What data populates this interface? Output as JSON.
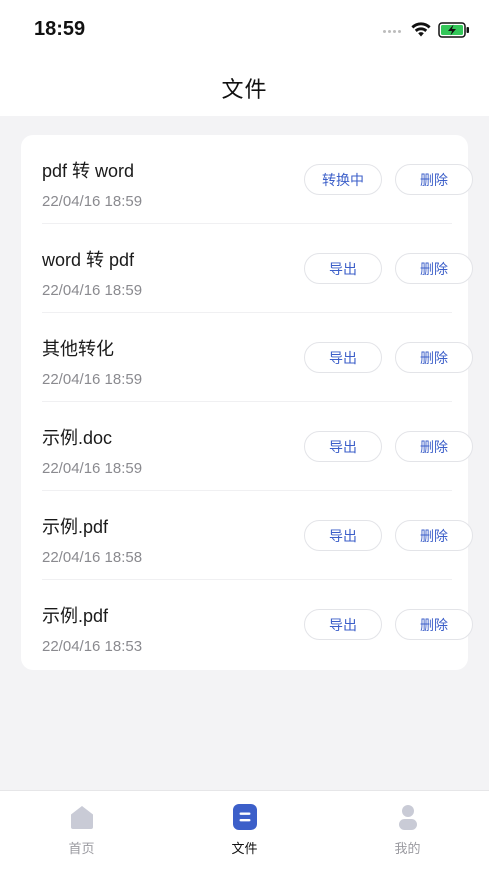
{
  "status_bar": {
    "time": "18:59",
    "icons": [
      "signal-dots-icon",
      "wifi-icon",
      "battery-charging-icon"
    ]
  },
  "nav": {
    "title": "文件"
  },
  "files": [
    {
      "name": "pdf 转 word",
      "time": "22/04/16 18:59",
      "primary_action": "转换中",
      "delete_action": "删除"
    },
    {
      "name": "word 转 pdf",
      "time": "22/04/16 18:59",
      "primary_action": "导出",
      "delete_action": "删除"
    },
    {
      "name": "其他转化",
      "time": "22/04/16 18:59",
      "primary_action": "导出",
      "delete_action": "删除"
    },
    {
      "name": "示例.doc",
      "time": "22/04/16 18:59",
      "primary_action": "导出",
      "delete_action": "删除"
    },
    {
      "name": "示例.pdf",
      "time": "22/04/16 18:58",
      "primary_action": "导出",
      "delete_action": "删除"
    },
    {
      "name": "示例.pdf",
      "time": "22/04/16 18:53",
      "primary_action": "导出",
      "delete_action": "删除"
    }
  ],
  "tab_bar": {
    "tabs": [
      {
        "label": "首页",
        "icon": "home-icon",
        "active": false
      },
      {
        "label": "文件",
        "icon": "file-icon",
        "active": true
      },
      {
        "label": "我的",
        "icon": "user-icon",
        "active": false
      }
    ]
  },
  "colors": {
    "accent": "#3c5fc9",
    "background": "#f3f3f5",
    "inactive_icon": "#c9cbd6",
    "battery_green": "#34c759"
  }
}
